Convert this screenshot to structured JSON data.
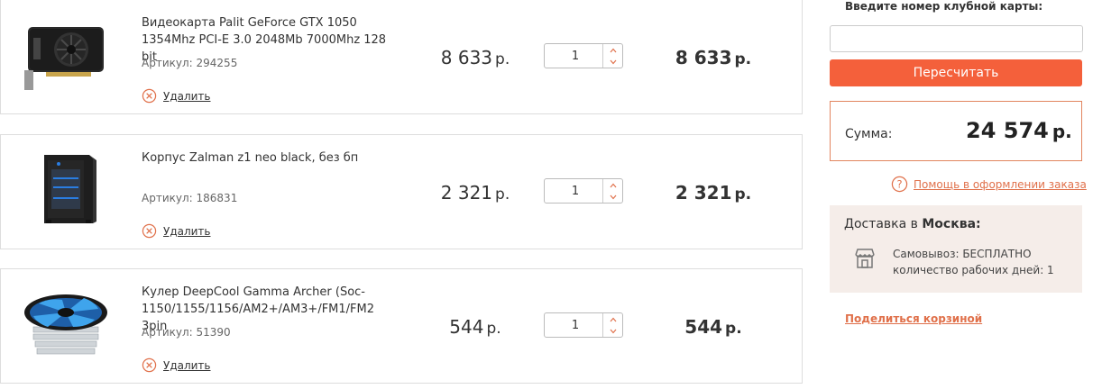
{
  "cart": {
    "items": [
      {
        "name": "Видеокарта Palit GeForce GTX 1050 1354Mhz PCI-E 3.0 2048Mb 7000Mhz 128 bit",
        "sku_label": "Артикул:",
        "sku": "294255",
        "remove_label": "Удалить",
        "unit_price": "8 633",
        "currency": "р.",
        "quantity": "1",
        "total_price": "8 633",
        "image_icon": "graphics-card-icon"
      },
      {
        "name": "Корпус Zalman z1 neo black, без бп",
        "sku_label": "Артикул:",
        "sku": "186831",
        "remove_label": "Удалить",
        "unit_price": "2 321",
        "currency": "р.",
        "quantity": "1",
        "total_price": "2 321",
        "image_icon": "pc-case-icon"
      },
      {
        "name": "Кулер DeepCool Gamma Archer (Soc-1150/1155/1156/AM2+/AM3+/FM1/FM2 3pin",
        "sku_label": "Артикул:",
        "sku": "51390",
        "remove_label": "Удалить",
        "unit_price": "544",
        "currency": "р.",
        "quantity": "1",
        "total_price": "544",
        "image_icon": "cpu-cooler-icon"
      }
    ]
  },
  "sidebar": {
    "club_card_label": "Введите номер клубной карты:",
    "club_card_value": "",
    "recalc_button": "Пересчитать",
    "sum_label": "Сумма:",
    "sum_value": "24 574",
    "currency": "р.",
    "help_link": "Помощь в оформлении заказа",
    "delivery_prefix": "Доставка в",
    "delivery_city": "Москва:",
    "pickup_line1": "Самовывоз: БЕСПЛАТНО",
    "pickup_line2": "количество рабочих дней: 1",
    "share_link": "Поделиться корзиной"
  },
  "colors": {
    "accent": "#f4603b",
    "link": "#e0704a",
    "delivery_bg": "#f5ede9"
  }
}
